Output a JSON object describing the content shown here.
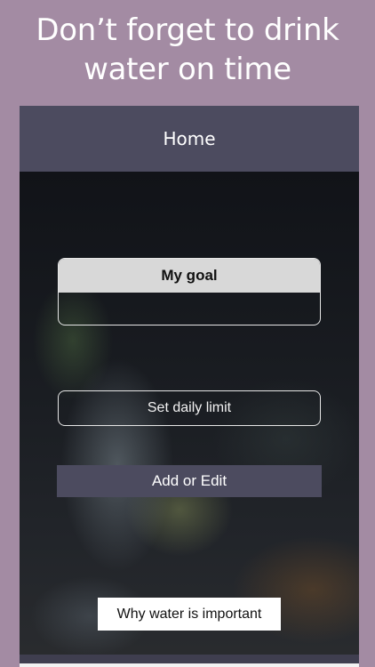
{
  "promo": {
    "line1": "Don’t forget to drink",
    "line2": "water on time"
  },
  "navbar": {
    "title": "Home"
  },
  "goal_card": {
    "title": "My goal",
    "value": ""
  },
  "buttons": {
    "set_limit": "Set daily limit",
    "add_edit": "Add or Edit",
    "why_water": "Why water is important"
  },
  "colors": {
    "background": "#a38ba3",
    "navbar": "#4c4b5f",
    "accent_button": "#4c4b5f",
    "card_header": "#d8d8d8"
  }
}
